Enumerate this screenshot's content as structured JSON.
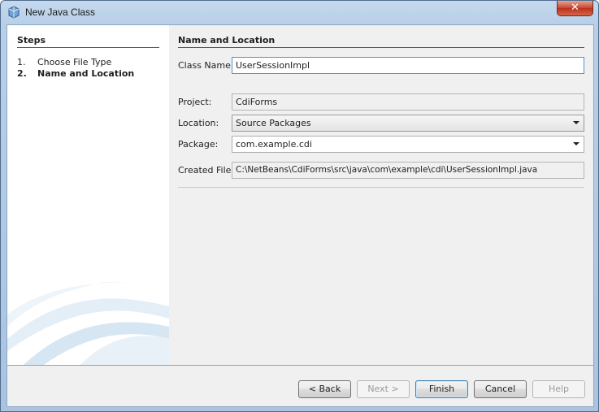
{
  "window": {
    "title": "New Java Class"
  },
  "steps": {
    "title": "Steps",
    "items": [
      {
        "number": "1.",
        "label": "Choose File Type"
      },
      {
        "number": "2.",
        "label": "Name and Location"
      }
    ]
  },
  "form": {
    "title": "Name and Location",
    "class_name": {
      "label": "Class Name:",
      "value": "UserSessionImpl"
    },
    "project": {
      "label": "Project:",
      "value": "CdiForms"
    },
    "location": {
      "label": "Location:",
      "value": "Source Packages"
    },
    "package": {
      "label": "Package:",
      "value": "com.example.cdi"
    },
    "created_file": {
      "label": "Created File:",
      "value": "C:\\NetBeans\\CdiForms\\src\\java\\com\\example\\cdi\\UserSessionImpl.java"
    }
  },
  "buttons": {
    "back": "< Back",
    "next": "Next >",
    "finish": "Finish",
    "cancel": "Cancel",
    "help": "Help"
  },
  "colors": {
    "title_bar": "#b8cfe8",
    "close_button": "#c7452d",
    "default_button_border": "#3c7fb1"
  }
}
